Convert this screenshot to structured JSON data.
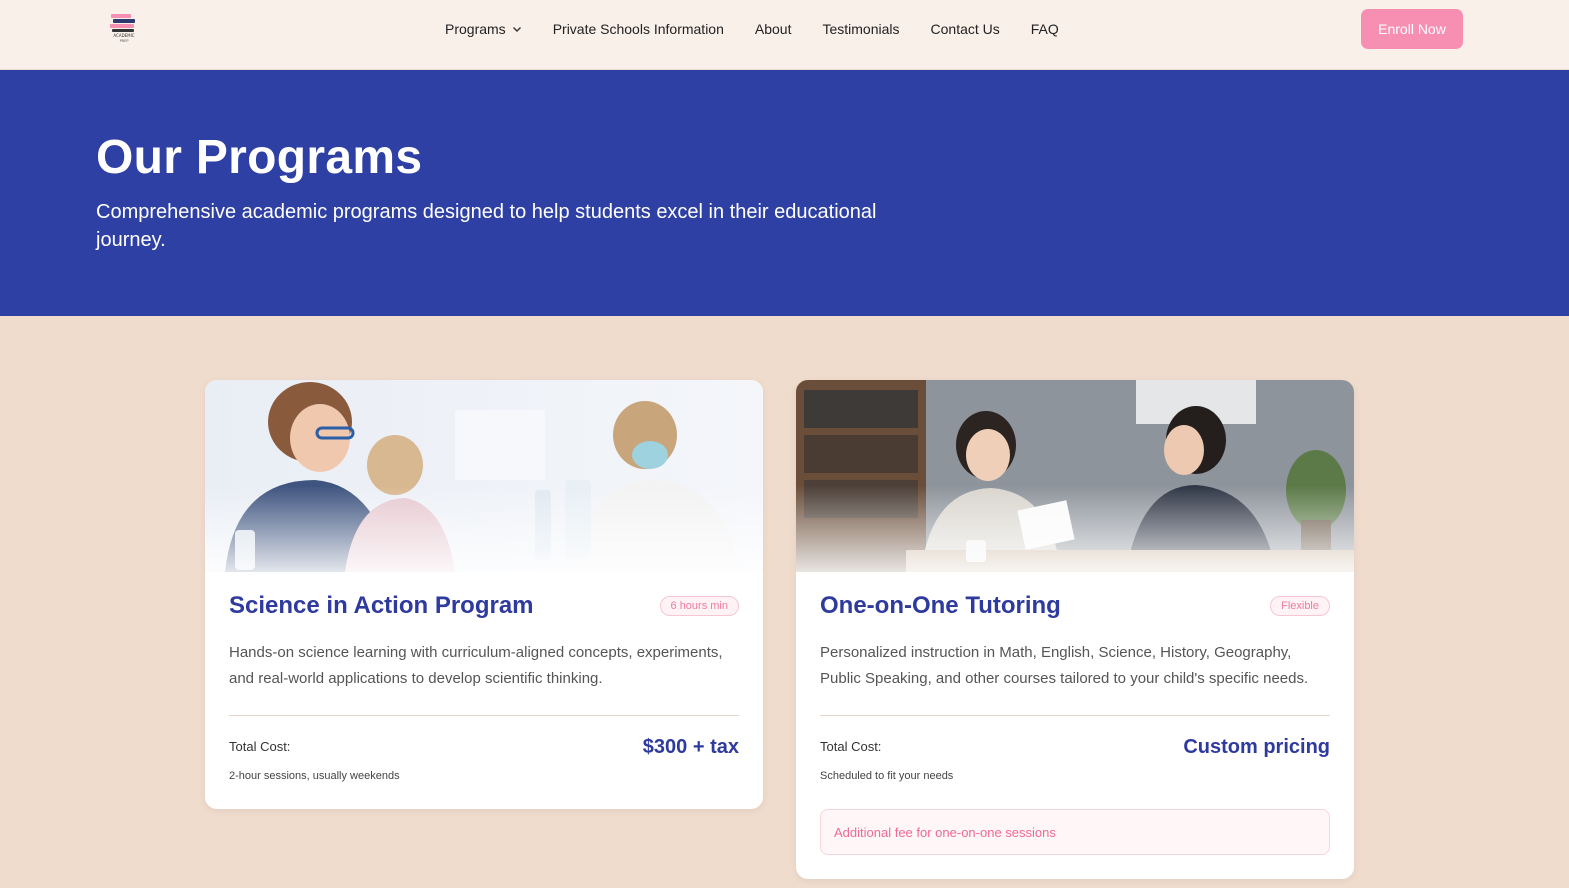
{
  "brand": {
    "logo_text": "ACADEMIC PREP",
    "accent": "#f78fb3",
    "primary": "#2e40a4"
  },
  "nav": {
    "items": [
      {
        "label": "Programs",
        "has_dropdown": true
      },
      {
        "label": "Private Schools Information"
      },
      {
        "label": "About"
      },
      {
        "label": "Testimonials"
      },
      {
        "label": "Contact Us"
      },
      {
        "label": "FAQ"
      }
    ],
    "cta": "Enroll Now"
  },
  "hero": {
    "title": "Our Programs",
    "subtitle": "Comprehensive academic programs designed to help students excel in their educational journey."
  },
  "programs": [
    {
      "title": "Science in Action Program",
      "badge": "6 hours min",
      "description": "Hands-on science learning with curriculum-aligned concepts, experiments, and real-world applications to develop scientific thinking.",
      "cost_label": "Total Cost:",
      "price": "$300 + tax",
      "note": "2-hour sessions, usually weekends",
      "image": "children-science-lab"
    },
    {
      "title": "One-on-One Tutoring",
      "badge": "Flexible",
      "description": "Personalized instruction in Math, English, Science, History, Geography, Public Speaking, and other courses tailored to your child's specific needs.",
      "cost_label": "Total Cost:",
      "price": "Custom pricing",
      "note": "Scheduled to fit your needs",
      "fee_note": "Additional fee for one-on-one sessions",
      "image": "tutor-and-student"
    }
  ]
}
